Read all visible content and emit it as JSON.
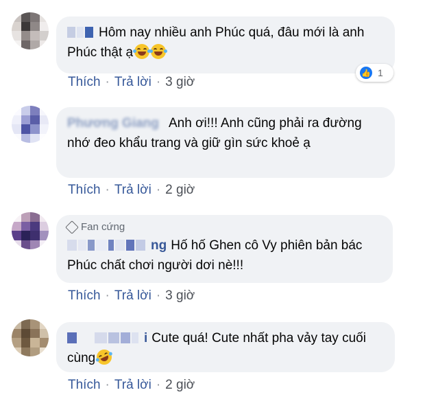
{
  "comments": [
    {
      "text": "Hôm nay nhiều anh Phúc quá, đâu mới là anh Phúc thật ạ",
      "reaction_count": "1",
      "actions": {
        "like": "Thích",
        "reply": "Trả lời",
        "time": "3 giờ"
      }
    },
    {
      "name_partial": "Phương Giang",
      "text": "Anh ơi!!! Anh cũng phải ra đường nhớ đeo khẩu trang và giữ gìn sức khoẻ ạ",
      "actions": {
        "like": "Thích",
        "reply": "Trả lời",
        "time": "2 giờ"
      }
    },
    {
      "badge": "Fan cứng",
      "name_partial": "ng",
      "text": "Hố hố Ghen cô Vy phiên bản bác Phúc chất chơi người dơi nè!!!",
      "actions": {
        "like": "Thích",
        "reply": "Trả lời",
        "time": "3 giờ"
      }
    },
    {
      "name_partial": "i",
      "text": "Cute quá! Cute nhất pha vảy tay cuối cùng",
      "actions": {
        "like": "Thích",
        "reply": "Trả lời",
        "time": "2 giờ"
      }
    }
  ],
  "colors": {
    "link": "#365899",
    "bubble": "#f0f2f5",
    "like_blue": "#1877f2"
  },
  "icons": [
    "grinning-tears-emoji",
    "like-icon",
    "fan-badge-icon",
    "rofl-emoji"
  ]
}
